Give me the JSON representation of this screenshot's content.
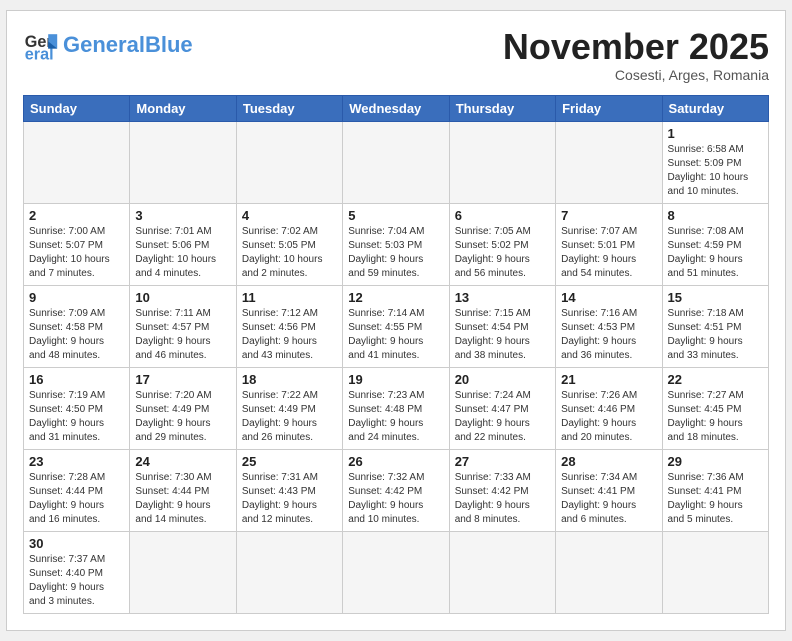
{
  "header": {
    "logo_general": "General",
    "logo_blue": "Blue",
    "month_title": "November 2025",
    "subtitle": "Cosesti, Arges, Romania"
  },
  "days_of_week": [
    "Sunday",
    "Monday",
    "Tuesday",
    "Wednesday",
    "Thursday",
    "Friday",
    "Saturday"
  ],
  "weeks": [
    [
      {
        "day": "",
        "info": "",
        "empty": true
      },
      {
        "day": "",
        "info": "",
        "empty": true
      },
      {
        "day": "",
        "info": "",
        "empty": true
      },
      {
        "day": "",
        "info": "",
        "empty": true
      },
      {
        "day": "",
        "info": "",
        "empty": true
      },
      {
        "day": "",
        "info": "",
        "empty": true
      },
      {
        "day": "1",
        "info": "Sunrise: 6:58 AM\nSunset: 5:09 PM\nDaylight: 10 hours\nand 10 minutes."
      }
    ],
    [
      {
        "day": "2",
        "info": "Sunrise: 7:00 AM\nSunset: 5:07 PM\nDaylight: 10 hours\nand 7 minutes."
      },
      {
        "day": "3",
        "info": "Sunrise: 7:01 AM\nSunset: 5:06 PM\nDaylight: 10 hours\nand 4 minutes."
      },
      {
        "day": "4",
        "info": "Sunrise: 7:02 AM\nSunset: 5:05 PM\nDaylight: 10 hours\nand 2 minutes."
      },
      {
        "day": "5",
        "info": "Sunrise: 7:04 AM\nSunset: 5:03 PM\nDaylight: 9 hours\nand 59 minutes."
      },
      {
        "day": "6",
        "info": "Sunrise: 7:05 AM\nSunset: 5:02 PM\nDaylight: 9 hours\nand 56 minutes."
      },
      {
        "day": "7",
        "info": "Sunrise: 7:07 AM\nSunset: 5:01 PM\nDaylight: 9 hours\nand 54 minutes."
      },
      {
        "day": "8",
        "info": "Sunrise: 7:08 AM\nSunset: 4:59 PM\nDaylight: 9 hours\nand 51 minutes."
      }
    ],
    [
      {
        "day": "9",
        "info": "Sunrise: 7:09 AM\nSunset: 4:58 PM\nDaylight: 9 hours\nand 48 minutes."
      },
      {
        "day": "10",
        "info": "Sunrise: 7:11 AM\nSunset: 4:57 PM\nDaylight: 9 hours\nand 46 minutes."
      },
      {
        "day": "11",
        "info": "Sunrise: 7:12 AM\nSunset: 4:56 PM\nDaylight: 9 hours\nand 43 minutes."
      },
      {
        "day": "12",
        "info": "Sunrise: 7:14 AM\nSunset: 4:55 PM\nDaylight: 9 hours\nand 41 minutes."
      },
      {
        "day": "13",
        "info": "Sunrise: 7:15 AM\nSunset: 4:54 PM\nDaylight: 9 hours\nand 38 minutes."
      },
      {
        "day": "14",
        "info": "Sunrise: 7:16 AM\nSunset: 4:53 PM\nDaylight: 9 hours\nand 36 minutes."
      },
      {
        "day": "15",
        "info": "Sunrise: 7:18 AM\nSunset: 4:51 PM\nDaylight: 9 hours\nand 33 minutes."
      }
    ],
    [
      {
        "day": "16",
        "info": "Sunrise: 7:19 AM\nSunset: 4:50 PM\nDaylight: 9 hours\nand 31 minutes."
      },
      {
        "day": "17",
        "info": "Sunrise: 7:20 AM\nSunset: 4:49 PM\nDaylight: 9 hours\nand 29 minutes."
      },
      {
        "day": "18",
        "info": "Sunrise: 7:22 AM\nSunset: 4:49 PM\nDaylight: 9 hours\nand 26 minutes."
      },
      {
        "day": "19",
        "info": "Sunrise: 7:23 AM\nSunset: 4:48 PM\nDaylight: 9 hours\nand 24 minutes."
      },
      {
        "day": "20",
        "info": "Sunrise: 7:24 AM\nSunset: 4:47 PM\nDaylight: 9 hours\nand 22 minutes."
      },
      {
        "day": "21",
        "info": "Sunrise: 7:26 AM\nSunset: 4:46 PM\nDaylight: 9 hours\nand 20 minutes."
      },
      {
        "day": "22",
        "info": "Sunrise: 7:27 AM\nSunset: 4:45 PM\nDaylight: 9 hours\nand 18 minutes."
      }
    ],
    [
      {
        "day": "23",
        "info": "Sunrise: 7:28 AM\nSunset: 4:44 PM\nDaylight: 9 hours\nand 16 minutes."
      },
      {
        "day": "24",
        "info": "Sunrise: 7:30 AM\nSunset: 4:44 PM\nDaylight: 9 hours\nand 14 minutes."
      },
      {
        "day": "25",
        "info": "Sunrise: 7:31 AM\nSunset: 4:43 PM\nDaylight: 9 hours\nand 12 minutes."
      },
      {
        "day": "26",
        "info": "Sunrise: 7:32 AM\nSunset: 4:42 PM\nDaylight: 9 hours\nand 10 minutes."
      },
      {
        "day": "27",
        "info": "Sunrise: 7:33 AM\nSunset: 4:42 PM\nDaylight: 9 hours\nand 8 minutes."
      },
      {
        "day": "28",
        "info": "Sunrise: 7:34 AM\nSunset: 4:41 PM\nDaylight: 9 hours\nand 6 minutes."
      },
      {
        "day": "29",
        "info": "Sunrise: 7:36 AM\nSunset: 4:41 PM\nDaylight: 9 hours\nand 5 minutes."
      }
    ],
    [
      {
        "day": "30",
        "info": "Sunrise: 7:37 AM\nSunset: 4:40 PM\nDaylight: 9 hours\nand 3 minutes."
      },
      {
        "day": "",
        "info": "",
        "empty": true
      },
      {
        "day": "",
        "info": "",
        "empty": true
      },
      {
        "day": "",
        "info": "",
        "empty": true
      },
      {
        "day": "",
        "info": "",
        "empty": true
      },
      {
        "day": "",
        "info": "",
        "empty": true
      },
      {
        "day": "",
        "info": "",
        "empty": true
      }
    ]
  ]
}
